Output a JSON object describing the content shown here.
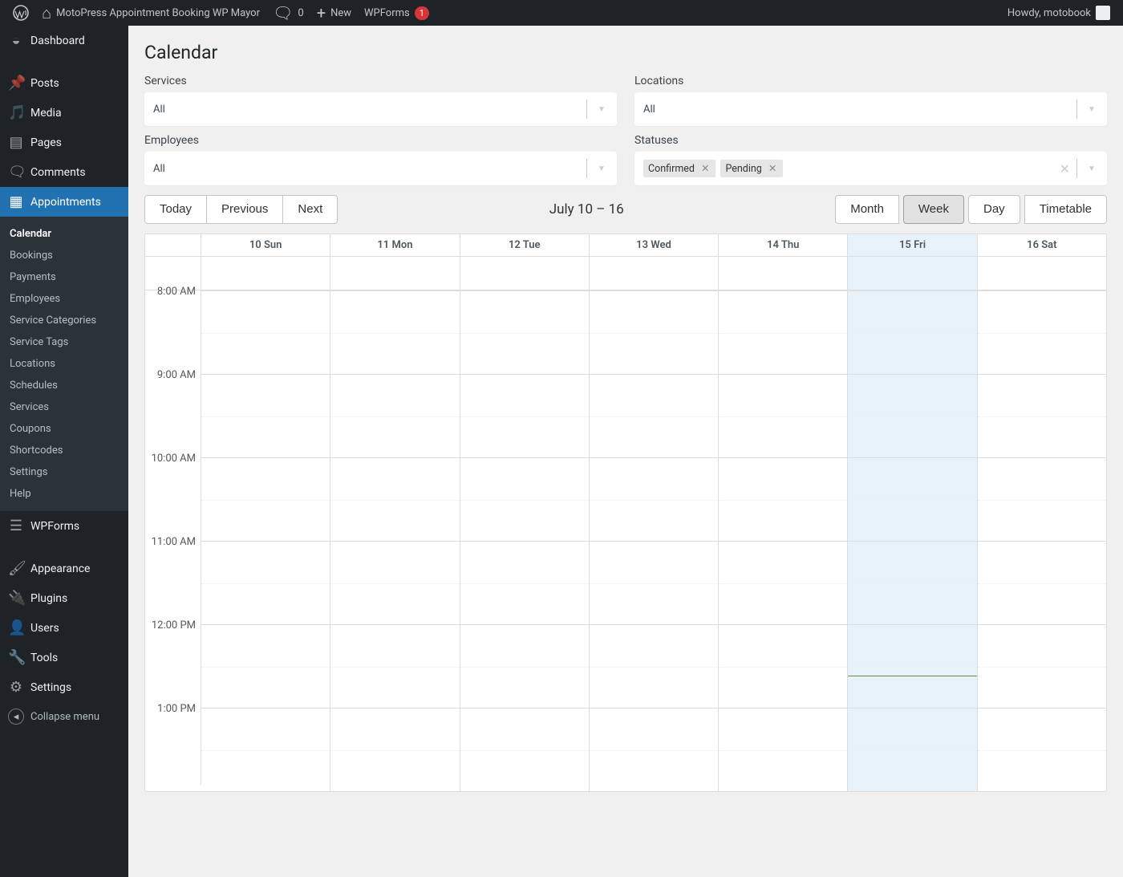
{
  "adminbar": {
    "site_title": "MotoPress Appointment Booking WP Mayor",
    "comments_count": "0",
    "new_label": "New",
    "wpforms_label": "WPForms",
    "wpforms_badge": "1",
    "howdy": "Howdy, motobook"
  },
  "sidebar": {
    "items": [
      {
        "label": "Dashboard",
        "icon": "◈"
      },
      {
        "label": "Posts",
        "icon": "📌"
      },
      {
        "label": "Media",
        "icon": "🎵"
      },
      {
        "label": "Pages",
        "icon": "📄"
      },
      {
        "label": "Comments",
        "icon": "💬"
      },
      {
        "label": "Appointments",
        "icon": "📅"
      },
      {
        "label": "WPForms",
        "icon": "☰"
      },
      {
        "label": "Appearance",
        "icon": "🖌"
      },
      {
        "label": "Plugins",
        "icon": "🔌"
      },
      {
        "label": "Users",
        "icon": "👤"
      },
      {
        "label": "Tools",
        "icon": "🔧"
      },
      {
        "label": "Settings",
        "icon": "⚙"
      }
    ],
    "submenu": [
      "Calendar",
      "Bookings",
      "Payments",
      "Employees",
      "Service Categories",
      "Service Tags",
      "Locations",
      "Schedules",
      "Services",
      "Coupons",
      "Shortcodes",
      "Settings",
      "Help"
    ],
    "collapse": "Collapse menu"
  },
  "page": {
    "title": "Calendar"
  },
  "filters": {
    "services": {
      "label": "Services",
      "value": "All"
    },
    "locations": {
      "label": "Locations",
      "value": "All"
    },
    "employees": {
      "label": "Employees",
      "value": "All"
    },
    "statuses": {
      "label": "Statuses",
      "tags": [
        "Confirmed",
        "Pending"
      ]
    }
  },
  "toolbar": {
    "today": "Today",
    "prev": "Previous",
    "next": "Next",
    "range": "July 10 – 16",
    "views": {
      "month": "Month",
      "week": "Week",
      "day": "Day",
      "timetable": "Timetable"
    }
  },
  "calendar": {
    "days": [
      "10 Sun",
      "11 Mon",
      "12 Tue",
      "13 Wed",
      "14 Thu",
      "15 Fri",
      "16 Sat"
    ],
    "today_index": 5,
    "hours": [
      "8:00 AM",
      "9:00 AM",
      "10:00 AM",
      "11:00 AM",
      "12:00 PM",
      "1:00 PM"
    ],
    "now_minute_offset": 0.61
  }
}
